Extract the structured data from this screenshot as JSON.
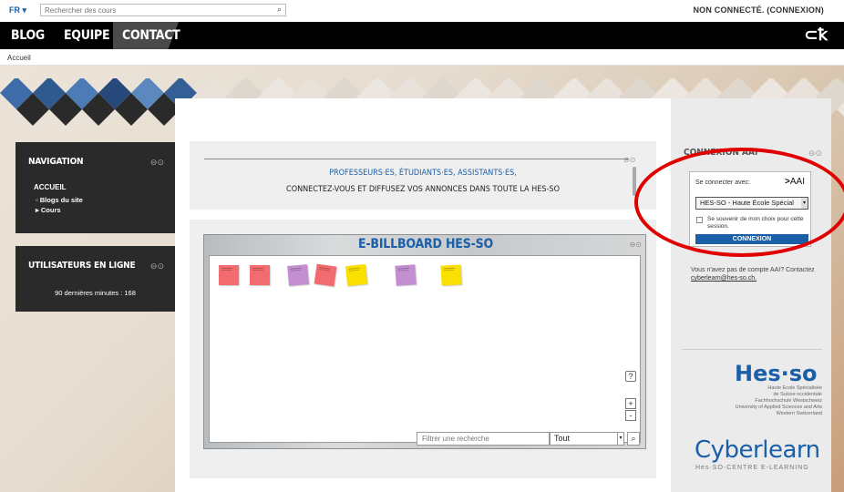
{
  "topbar": {
    "lang": "FR",
    "search_placeholder": "Rechercher des cours",
    "login_status": "NON CONNECTÉ. (CONNEXION)"
  },
  "nav": {
    "items": [
      "BLOG",
      "EQUIPE",
      "CONTACT"
    ]
  },
  "breadcrumb": "Accueil",
  "navigation_block": {
    "title": "NAVIGATION",
    "home": "ACCUEIL",
    "items": [
      "Blogs du site",
      "Cours"
    ]
  },
  "online_users_block": {
    "title": "UTILISATEURS EN LIGNE",
    "text": "90 dernières minutes : 168"
  },
  "announcement": {
    "line1": "PROFESSEURS·ES, ÉTUDIANTS·ES, ASSISTANTS·ES,",
    "line2": "CONNECTEZ-VOUS ET DIFFUSEZ VOS ANNONCES DANS TOUTE LA HES-SO"
  },
  "billboard": {
    "title": "E-BILLBOARD HES-SO",
    "filter_placeholder": "Filtrer une recherche",
    "filter_select": "Tout",
    "help": "?",
    "zoom_in": "+",
    "zoom_out": "-"
  },
  "aai": {
    "title": "CONNEXION AAI",
    "connect_with": "Se connecter avec:",
    "logo": "AAI",
    "institution": "HES-SO - Haute École Spécial",
    "remember": "Se souvenir de mon choix pour cette session.",
    "button": "CONNEXION",
    "note": "Vous n'avez pas de compte AAI? Contactez",
    "email": "cyberlearn@hes-so.ch."
  },
  "hesso": {
    "logo": "Hes·so",
    "lines": [
      "Haute Ecole Spécialisée",
      "de Suisse occidentale",
      "Fachhochschule Westschweiz",
      "University of Applied Sciences and Arts",
      "Western Switzerland"
    ]
  },
  "cyberlearn": {
    "logo": "Cyberlearn",
    "sub": "Hes·SO-CENTRE E-LEARNING"
  }
}
